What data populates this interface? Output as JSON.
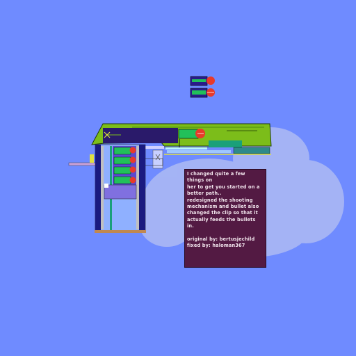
{
  "scene": {
    "colors": {
      "sky": "#6f8bff",
      "cloud": "#aab8f4",
      "gun_body": "#7cbd1a",
      "dark_panel": "#2a1a6a",
      "bullet_casing": "#22c05a",
      "bullet_tip": "#e83a2a",
      "note_bg": "#531a43",
      "note_text": "#f3e6ee"
    },
    "objects": [
      "gun-body",
      "magazine-clip",
      "bullet",
      "info-note"
    ]
  },
  "note": {
    "lines": [
      "I changed quite a few things on",
      "her to get you started on a",
      "better path..",
      "redesigned the shooting",
      "mechanism and bullet also",
      "changed the clip so that it",
      "actually feeds the bullets in."
    ],
    "credits": [
      "original by: bertusjechild",
      "fixed by: haloman367"
    ]
  }
}
